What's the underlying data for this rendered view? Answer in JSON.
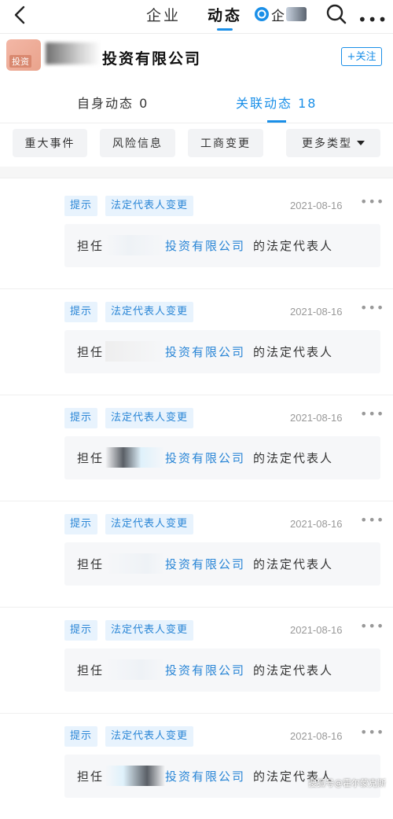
{
  "nav": {
    "tabs": [
      "企业",
      "动态"
    ],
    "active_index": 1,
    "qcc_label": "企",
    "more_label": "•••"
  },
  "company": {
    "logo_text": "投资",
    "name": "投资有限公司",
    "follow_label": "+关注"
  },
  "subtabs": [
    {
      "label": "自身动态 0"
    },
    {
      "label": "关联动态 18"
    }
  ],
  "filters": [
    "重大事件",
    "风险信息",
    "工商变更",
    "更多类型"
  ],
  "events": [
    {
      "tag1": "提示",
      "tag2": "法定代表人变更",
      "date": "2021-08-16",
      "more": "•••",
      "prefix": "担任",
      "company": "投资有限公司",
      "suffix": "的法定代表人"
    },
    {
      "tag1": "提示",
      "tag2": "法定代表人变更",
      "date": "2021-08-16",
      "more": "•••",
      "prefix": "担任",
      "company": "投资有限公司",
      "suffix": "的法定代表人"
    },
    {
      "tag1": "提示",
      "tag2": "法定代表人变更",
      "date": "2021-08-16",
      "more": "•••",
      "prefix": "担任",
      "company": "投资有限公司",
      "suffix": "的法定代表人"
    },
    {
      "tag1": "提示",
      "tag2": "法定代表人变更",
      "date": "2021-08-16",
      "more": "•••",
      "prefix": "担任",
      "company": "投资有限公司",
      "suffix": "的法定代表人"
    },
    {
      "tag1": "提示",
      "tag2": "法定代表人变更",
      "date": "2021-08-16",
      "more": "•••",
      "prefix": "担任",
      "company": "投资有限公司",
      "suffix": "的法定代表人"
    },
    {
      "tag1": "提示",
      "tag2": "法定代表人变更",
      "date": "2021-08-16",
      "more": "•••",
      "prefix": "担任",
      "company": "投资有限公司",
      "suffix": "的法定代表人"
    }
  ],
  "watermark": "搜狐号@霍尔蒙克斯",
  "colors": {
    "accent": "#1a8fe8",
    "tag_bg": "#e8f3fd",
    "link": "#2a86d6"
  }
}
